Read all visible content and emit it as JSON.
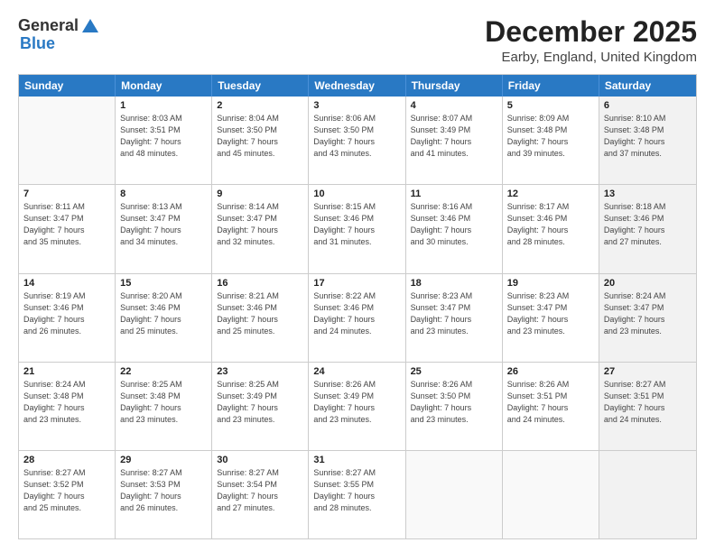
{
  "logo": {
    "general": "General",
    "blue": "Blue"
  },
  "title": {
    "month": "December 2025",
    "location": "Earby, England, United Kingdom"
  },
  "calendar": {
    "headers": [
      "Sunday",
      "Monday",
      "Tuesday",
      "Wednesday",
      "Thursday",
      "Friday",
      "Saturday"
    ],
    "rows": [
      [
        {
          "day": "",
          "info": "",
          "empty": true
        },
        {
          "day": "1",
          "info": "Sunrise: 8:03 AM\nSunset: 3:51 PM\nDaylight: 7 hours\nand 48 minutes."
        },
        {
          "day": "2",
          "info": "Sunrise: 8:04 AM\nSunset: 3:50 PM\nDaylight: 7 hours\nand 45 minutes."
        },
        {
          "day": "3",
          "info": "Sunrise: 8:06 AM\nSunset: 3:50 PM\nDaylight: 7 hours\nand 43 minutes."
        },
        {
          "day": "4",
          "info": "Sunrise: 8:07 AM\nSunset: 3:49 PM\nDaylight: 7 hours\nand 41 minutes."
        },
        {
          "day": "5",
          "info": "Sunrise: 8:09 AM\nSunset: 3:48 PM\nDaylight: 7 hours\nand 39 minutes."
        },
        {
          "day": "6",
          "info": "Sunrise: 8:10 AM\nSunset: 3:48 PM\nDaylight: 7 hours\nand 37 minutes.",
          "shaded": true
        }
      ],
      [
        {
          "day": "7",
          "info": "Sunrise: 8:11 AM\nSunset: 3:47 PM\nDaylight: 7 hours\nand 35 minutes."
        },
        {
          "day": "8",
          "info": "Sunrise: 8:13 AM\nSunset: 3:47 PM\nDaylight: 7 hours\nand 34 minutes."
        },
        {
          "day": "9",
          "info": "Sunrise: 8:14 AM\nSunset: 3:47 PM\nDaylight: 7 hours\nand 32 minutes."
        },
        {
          "day": "10",
          "info": "Sunrise: 8:15 AM\nSunset: 3:46 PM\nDaylight: 7 hours\nand 31 minutes."
        },
        {
          "day": "11",
          "info": "Sunrise: 8:16 AM\nSunset: 3:46 PM\nDaylight: 7 hours\nand 30 minutes."
        },
        {
          "day": "12",
          "info": "Sunrise: 8:17 AM\nSunset: 3:46 PM\nDaylight: 7 hours\nand 28 minutes."
        },
        {
          "day": "13",
          "info": "Sunrise: 8:18 AM\nSunset: 3:46 PM\nDaylight: 7 hours\nand 27 minutes.",
          "shaded": true
        }
      ],
      [
        {
          "day": "14",
          "info": "Sunrise: 8:19 AM\nSunset: 3:46 PM\nDaylight: 7 hours\nand 26 minutes."
        },
        {
          "day": "15",
          "info": "Sunrise: 8:20 AM\nSunset: 3:46 PM\nDaylight: 7 hours\nand 25 minutes."
        },
        {
          "day": "16",
          "info": "Sunrise: 8:21 AM\nSunset: 3:46 PM\nDaylight: 7 hours\nand 25 minutes."
        },
        {
          "day": "17",
          "info": "Sunrise: 8:22 AM\nSunset: 3:46 PM\nDaylight: 7 hours\nand 24 minutes."
        },
        {
          "day": "18",
          "info": "Sunrise: 8:23 AM\nSunset: 3:47 PM\nDaylight: 7 hours\nand 23 minutes."
        },
        {
          "day": "19",
          "info": "Sunrise: 8:23 AM\nSunset: 3:47 PM\nDaylight: 7 hours\nand 23 minutes."
        },
        {
          "day": "20",
          "info": "Sunrise: 8:24 AM\nSunset: 3:47 PM\nDaylight: 7 hours\nand 23 minutes.",
          "shaded": true
        }
      ],
      [
        {
          "day": "21",
          "info": "Sunrise: 8:24 AM\nSunset: 3:48 PM\nDaylight: 7 hours\nand 23 minutes."
        },
        {
          "day": "22",
          "info": "Sunrise: 8:25 AM\nSunset: 3:48 PM\nDaylight: 7 hours\nand 23 minutes."
        },
        {
          "day": "23",
          "info": "Sunrise: 8:25 AM\nSunset: 3:49 PM\nDaylight: 7 hours\nand 23 minutes."
        },
        {
          "day": "24",
          "info": "Sunrise: 8:26 AM\nSunset: 3:49 PM\nDaylight: 7 hours\nand 23 minutes."
        },
        {
          "day": "25",
          "info": "Sunrise: 8:26 AM\nSunset: 3:50 PM\nDaylight: 7 hours\nand 23 minutes."
        },
        {
          "day": "26",
          "info": "Sunrise: 8:26 AM\nSunset: 3:51 PM\nDaylight: 7 hours\nand 24 minutes."
        },
        {
          "day": "27",
          "info": "Sunrise: 8:27 AM\nSunset: 3:51 PM\nDaylight: 7 hours\nand 24 minutes.",
          "shaded": true
        }
      ],
      [
        {
          "day": "28",
          "info": "Sunrise: 8:27 AM\nSunset: 3:52 PM\nDaylight: 7 hours\nand 25 minutes."
        },
        {
          "day": "29",
          "info": "Sunrise: 8:27 AM\nSunset: 3:53 PM\nDaylight: 7 hours\nand 26 minutes."
        },
        {
          "day": "30",
          "info": "Sunrise: 8:27 AM\nSunset: 3:54 PM\nDaylight: 7 hours\nand 27 minutes."
        },
        {
          "day": "31",
          "info": "Sunrise: 8:27 AM\nSunset: 3:55 PM\nDaylight: 7 hours\nand 28 minutes."
        },
        {
          "day": "",
          "info": "",
          "empty": true
        },
        {
          "day": "",
          "info": "",
          "empty": true
        },
        {
          "day": "",
          "info": "",
          "empty": true,
          "shaded": true
        }
      ]
    ]
  }
}
